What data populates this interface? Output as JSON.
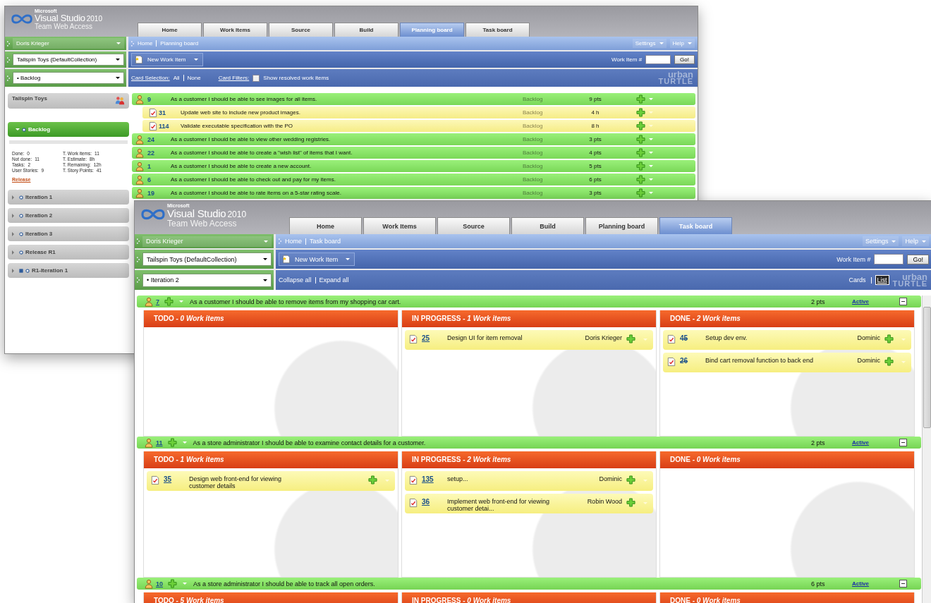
{
  "planning_window": {
    "kind": "planning",
    "logo": {
      "maker": "Microsoft",
      "product": "Visual Studio",
      "version": "2010",
      "subtitle": "Team Web Access"
    },
    "tabs": [
      {
        "label": "Home",
        "selected": false
      },
      {
        "label": "Work Items",
        "selected": false
      },
      {
        "label": "Source",
        "selected": false
      },
      {
        "label": "Build",
        "selected": false
      },
      {
        "label": "Planning board",
        "selected": true
      },
      {
        "label": "Task board",
        "selected": false
      }
    ],
    "user": "Doris Krieger",
    "collection": "Tailspin Toys (DefaultCollection)",
    "iteration": "• Backlog",
    "breadcrumb": [
      "Home",
      "Planning board"
    ],
    "menus": [
      "Settings",
      "Help"
    ],
    "new_work_item": "New Work Item",
    "work_item_label": "Work Item #",
    "go_button": "Go!",
    "card_selection": {
      "label": "Card Selection:",
      "options": [
        "All",
        "None"
      ]
    },
    "card_filters": {
      "label": "Card Filters:",
      "checkbox_label": "Show resolved work items",
      "checked": false
    },
    "brand": {
      "line1": "urban",
      "line2": "TURTLE"
    },
    "sidebar": {
      "project": "Tailspin Toys",
      "iterations": [
        {
          "name": "Backlog",
          "selected": true,
          "expanded": true,
          "current": false,
          "stats": [
            {
              "label": "Done:",
              "value": "0"
            },
            {
              "label": "T. Work items:",
              "value": "11"
            },
            {
              "label": "Not done:",
              "value": "11"
            },
            {
              "label": "T. Estimate:",
              "value": "8h"
            },
            {
              "label": "Tasks:",
              "value": "2"
            },
            {
              "label": "T. Remaining:",
              "value": "12h"
            },
            {
              "label": "User Stories:",
              "value": "9"
            },
            {
              "label": "T. Story Points:",
              "value": "41"
            }
          ],
          "link": "Release"
        },
        {
          "name": "Iteration 1",
          "selected": false,
          "expanded": false,
          "current": false
        },
        {
          "name": "Iteration 2",
          "selected": false,
          "expanded": false,
          "current": false
        },
        {
          "name": "Iteration 3",
          "selected": false,
          "expanded": false,
          "current": false
        },
        {
          "name": "Release R1",
          "selected": false,
          "expanded": false,
          "current": false
        },
        {
          "name": "R1-Iteration 1",
          "selected": false,
          "expanded": false,
          "current": true
        }
      ]
    },
    "rows": [
      {
        "kind": "story",
        "id": "9",
        "title": "As a customer I should be able to see images for all items.",
        "state": "Backlog",
        "estimate": "9 pts"
      },
      {
        "kind": "task",
        "id": "31",
        "title": "Update web site to include new product images.",
        "state": "Backlog",
        "estimate": "4 h"
      },
      {
        "kind": "task",
        "id": "114",
        "title": "Validate executable specification with the PO",
        "state": "Backlog",
        "estimate": "8 h"
      },
      {
        "kind": "story",
        "id": "24",
        "title": "As a customer I should be able to view other wedding registries.",
        "state": "Backlog",
        "estimate": "3 pts"
      },
      {
        "kind": "story",
        "id": "22",
        "title": "As a customer I should be able to create a \"wish list\" of items that I want.",
        "state": "Backlog",
        "estimate": "4 pts"
      },
      {
        "kind": "story",
        "id": "1",
        "title": "As a customer I should be able to create a new account.",
        "state": "Backlog",
        "estimate": "5 pts"
      },
      {
        "kind": "story",
        "id": "6",
        "title": "As a customer I should be able to check out and pay for my items.",
        "state": "Backlog",
        "estimate": "6 pts"
      },
      {
        "kind": "story",
        "id": "19",
        "title": "As a customer I should be able to rate items on a 5-star rating scale.",
        "state": "Backlog",
        "estimate": "3 pts"
      }
    ]
  },
  "task_window": {
    "kind": "taskboard",
    "logo": {
      "maker": "Microsoft",
      "product": "Visual Studio",
      "version": "2010",
      "subtitle": "Team Web Access"
    },
    "tabs": [
      {
        "label": "Home",
        "selected": false
      },
      {
        "label": "Work Items",
        "selected": false
      },
      {
        "label": "Source",
        "selected": false
      },
      {
        "label": "Build",
        "selected": false
      },
      {
        "label": "Planning board",
        "selected": false
      },
      {
        "label": "Task board",
        "selected": true
      }
    ],
    "user": "Doris Krieger",
    "collection": "Tailspin Toys (DefaultCollection)",
    "iteration": "• Iteration 2",
    "breadcrumb": [
      "Home",
      "Task board"
    ],
    "menus": [
      "Settings",
      "Help"
    ],
    "new_work_item": "New Work Item",
    "work_item_label": "Work Item #",
    "go_button": "Go!",
    "view_actions": [
      "Collapse all",
      "Expand all"
    ],
    "views": [
      {
        "label": "Cards",
        "selected": false
      },
      {
        "label": "List",
        "selected": true
      }
    ],
    "brand": {
      "line1": "urban",
      "line2": "TURTLE"
    },
    "stories": [
      {
        "id": "7",
        "title": "As a customer I should be able to remove items from my shopping car cart.",
        "points": "2 pts",
        "state": "Active",
        "columns": [
          {
            "title": "TODO *- 0 Work items*"
          },
          {
            "title": "IN PROGRESS *- 1 Work items*",
            "cards": [
              {
                "id": "25",
                "title": "Design UI for item removal",
                "assignee": "Doris Krieger",
                "done": false
              }
            ]
          },
          {
            "title": "DONE *- 2 Work items*",
            "cards": [
              {
                "id": "45",
                "title": "Setup dev env.",
                "assignee": "Dominic",
                "done": true
              },
              {
                "id": "26",
                "title": "Bind cart removal function to back end",
                "assignee": "Dominic",
                "done": true
              }
            ]
          }
        ]
      },
      {
        "id": "11",
        "title": "As a store administrator I should be able to examine contact details for a customer.",
        "points": "2 pts",
        "state": "Active",
        "columns": [
          {
            "title": "TODO *- 1 Work items*",
            "cards": [
              {
                "id": "35",
                "title": "Design web front-end for viewing customer details",
                "done": false
              }
            ]
          },
          {
            "title": "IN PROGRESS *- 2 Work items*",
            "cards": [
              {
                "id": "135",
                "title": "setup...",
                "assignee": "Dominic",
                "done": false
              },
              {
                "id": "36",
                "title": "Implement web front-end for viewing customer detai...",
                "assignee": "Robin Wood",
                "done": false
              }
            ]
          },
          {
            "title": "DONE *- 0 Work items*"
          }
        ]
      },
      {
        "id": "10",
        "title": "As a store administrator I should be able to track all open orders.",
        "points": "6 pts",
        "state": "Active",
        "columns": [
          {
            "title": "TODO *- 5 Work items*"
          },
          {
            "title": "IN PROGRESS *- 0 Work items*"
          },
          {
            "title": "DONE *- 0 Work items*"
          }
        ]
      }
    ]
  }
}
